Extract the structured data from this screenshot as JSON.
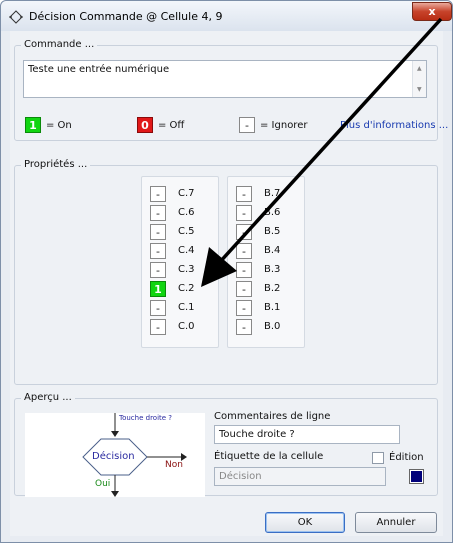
{
  "window": {
    "title": "Décision Commande @ Cellule 4, 9",
    "close_label": "x"
  },
  "commande": {
    "legend": "Commande ...",
    "text": "Teste une entrée numérique",
    "legend_items": [
      {
        "symbol": "1",
        "label": "= On"
      },
      {
        "symbol": "0",
        "label": "= Off"
      },
      {
        "symbol": "-",
        "label": "= Ignorer"
      }
    ],
    "more_info_link": "Plus d'informations ..."
  },
  "proprietes": {
    "legend": "Propriétés ...",
    "port_c": [
      {
        "state": "-",
        "label": "C.7"
      },
      {
        "state": "-",
        "label": "C.6"
      },
      {
        "state": "-",
        "label": "C.5"
      },
      {
        "state": "-",
        "label": "C.4"
      },
      {
        "state": "-",
        "label": "C.3"
      },
      {
        "state": "1",
        "label": "C.2"
      },
      {
        "state": "-",
        "label": "C.1"
      },
      {
        "state": "-",
        "label": "C.0"
      }
    ],
    "port_b": [
      {
        "state": "-",
        "label": "B.7"
      },
      {
        "state": "-",
        "label": "B.6"
      },
      {
        "state": "-",
        "label": "B.5"
      },
      {
        "state": "-",
        "label": "B.4"
      },
      {
        "state": "-",
        "label": "B.3"
      },
      {
        "state": "-",
        "label": "B.2"
      },
      {
        "state": "-",
        "label": "B.1"
      },
      {
        "state": "-",
        "label": "B.0"
      }
    ]
  },
  "apercu": {
    "legend": "Aperçu ...",
    "preview": {
      "top_label": "Touche droite ?",
      "node_label": "Décision",
      "no_label": "Non",
      "yes_label": "Oui"
    },
    "line_comment_label": "Commentaires de ligne",
    "line_comment_value": "Touche droite ?",
    "cell_label_label": "Étiquette de la cellule",
    "cell_label_placeholder": "Décision",
    "edition_label": "Édition",
    "edition_checked": false,
    "cell_color": "#00007a"
  },
  "buttons": {
    "ok": "OK",
    "cancel": "Annuler"
  },
  "colors": {
    "on": "#11d511",
    "off": "#e11818",
    "link": "#1a3bb0",
    "preview_text": "#2a2aa0",
    "preview_no": "#8a1010",
    "preview_yes": "#1a8a1a"
  }
}
